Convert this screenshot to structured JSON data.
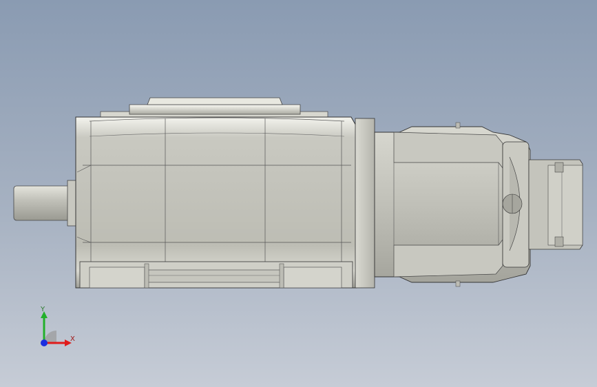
{
  "viewport": {
    "background_top": "#8a9bb2",
    "background_bottom": "#c6ccd6",
    "model": "rotary-indexer-with-servo-motor"
  },
  "triad": {
    "y_label": "Y",
    "x_label": "X",
    "y_color": "#22b02a",
    "x_color": "#e01b1b",
    "z_color": "#1a2ee0"
  }
}
